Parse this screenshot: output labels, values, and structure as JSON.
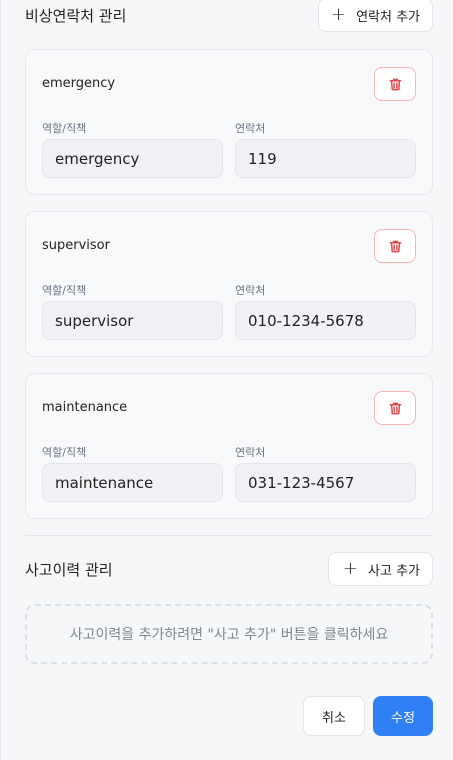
{
  "contacts_section": {
    "title": "비상연락처 관리",
    "add_label": "연락처 추가"
  },
  "contacts": [
    {
      "name": "emergency",
      "role_label": "역할/직책",
      "role": "emergency",
      "phone_label": "연락처",
      "phone": "119"
    },
    {
      "name": "supervisor",
      "role_label": "역할/직책",
      "role": "supervisor",
      "phone_label": "연락처",
      "phone": "010-1234-5678"
    },
    {
      "name": "maintenance",
      "role_label": "역할/직책",
      "role": "maintenance",
      "phone_label": "연락처",
      "phone": "031-123-4567"
    }
  ],
  "accidents_section": {
    "title": "사고이력 관리",
    "add_label": "사고 추가",
    "empty_message": "사고이력을 추가하려면 \"사고 추가\" 버튼을 클릭하세요"
  },
  "footer": {
    "cancel_label": "취소",
    "save_label": "수정"
  },
  "colors": {
    "primary": "#2f7ff5",
    "danger": "#e5484d"
  },
  "icons": {
    "add": "plus-icon",
    "delete": "trash-icon"
  }
}
